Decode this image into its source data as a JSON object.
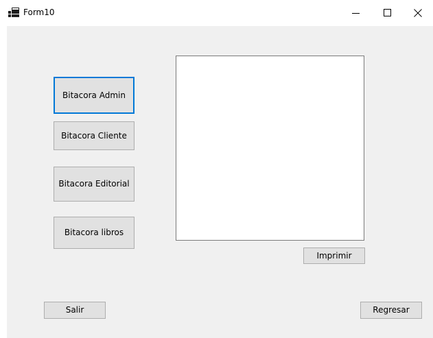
{
  "window": {
    "title": "Form10",
    "minimize_icon": "minimize-icon",
    "maximize_icon": "maximize-icon",
    "close_icon": "close-icon",
    "app_icon": "app-form-icon"
  },
  "buttons": {
    "bitacora_admin": "Bitacora Admin",
    "bitacora_cliente": "Bitacora Cliente",
    "bitacora_editorial": "Bitacora Editorial",
    "bitacora_libros": "Bitacora libros",
    "imprimir": "Imprimir",
    "salir": "Salir",
    "regresar": "Regresar"
  },
  "colors": {
    "client_background": "#f0f0f0",
    "button_background": "#e1e1e1",
    "focus_border": "#0078d7"
  }
}
